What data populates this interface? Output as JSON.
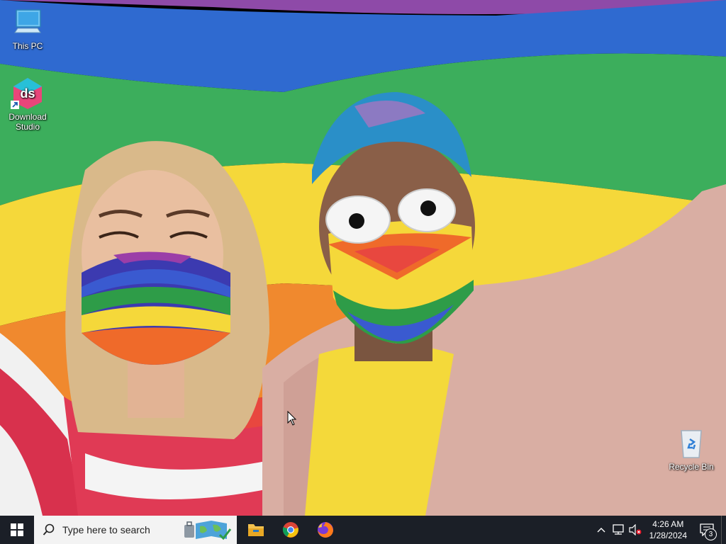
{
  "desktop": {
    "icons": [
      {
        "label": "This PC"
      },
      {
        "label": "Download Studio"
      },
      {
        "label": "Recycle Bin"
      }
    ],
    "wallpaper_colors": {
      "violet": "#8e4aa8",
      "blue": "#2f6ad0",
      "green": "#3cae5c",
      "yellow": "#f5d83a",
      "orange": "#f0892e",
      "red": "#e8473f"
    }
  },
  "taskbar": {
    "search_placeholder": "Type here to search",
    "pinned_apps": [
      "file-explorer-icon",
      "chrome-icon",
      "firefox-icon"
    ],
    "clock": {
      "time": "4:26 AM",
      "date": "1/28/2024"
    },
    "notifications_count": "3",
    "background_color": "#1b1f27"
  }
}
